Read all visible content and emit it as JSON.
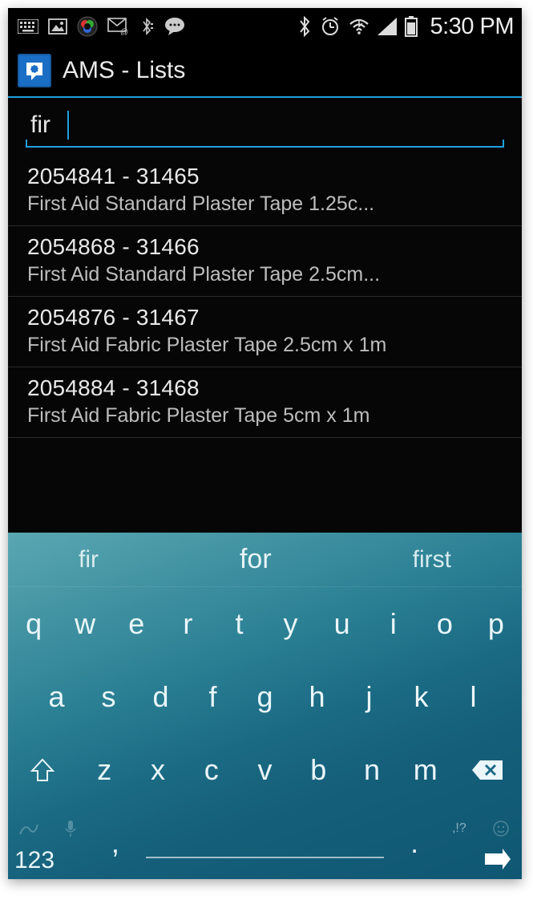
{
  "status": {
    "time": "5:30 PM",
    "icons_left": [
      "keyboard-icon",
      "picture-icon",
      "camera-color-icon",
      "mail-attach-icon",
      "bt-small-icon",
      "chat-bubble-icon"
    ],
    "icons_right": [
      "bluetooth-icon",
      "alarm-icon",
      "wifi-icon",
      "signal-icon",
      "battery-icon"
    ]
  },
  "app": {
    "title": "AMS - Lists"
  },
  "search": {
    "value": "fir",
    "placeholder": ""
  },
  "results": [
    {
      "code": "2054841 - 31465",
      "desc": "First Aid Standard Plaster Tape 1.25c..."
    },
    {
      "code": "2054868 - 31466",
      "desc": "First Aid Standard Plaster Tape 2.5cm..."
    },
    {
      "code": "2054876 - 31467",
      "desc": "First Aid Fabric Plaster Tape 2.5cm x 1m"
    },
    {
      "code": "2054884 - 31468",
      "desc": "First Aid Fabric Plaster Tape 5cm x 1m"
    }
  ],
  "keyboard": {
    "suggestions": [
      "fir",
      "for",
      "first"
    ],
    "row1": [
      "q",
      "w",
      "e",
      "r",
      "t",
      "y",
      "u",
      "i",
      "o",
      "p"
    ],
    "row2": [
      "a",
      "s",
      "d",
      "f",
      "g",
      "h",
      "j",
      "k",
      "l"
    ],
    "row3": [
      "z",
      "x",
      "c",
      "v",
      "b",
      "n",
      "m"
    ],
    "num_key": "123",
    "comma": ",",
    "period": ".",
    "punct": ",!?"
  }
}
